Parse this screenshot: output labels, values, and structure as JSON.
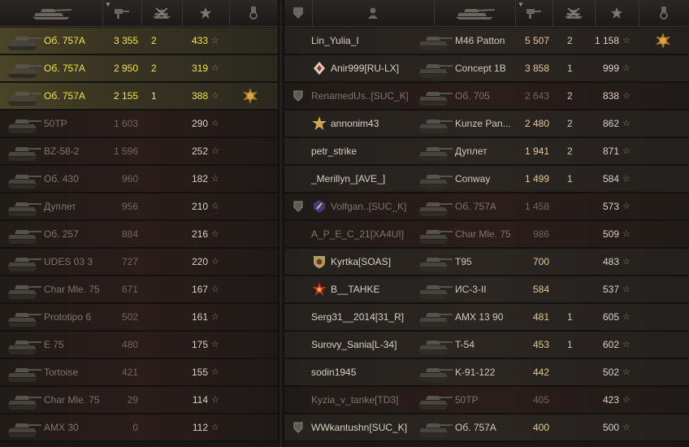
{
  "left_team": {
    "rows": [
      {
        "vehicle": "Об. 757А",
        "damage": "3 355",
        "frags": "2",
        "xp": "433",
        "state": "self",
        "medal": false
      },
      {
        "vehicle": "Об. 757А",
        "damage": "2 950",
        "frags": "2",
        "xp": "319",
        "state": "self",
        "medal": false
      },
      {
        "vehicle": "Об. 757А",
        "damage": "2 155",
        "frags": "1",
        "xp": "388",
        "state": "self",
        "medal": true
      },
      {
        "vehicle": "50TP",
        "damage": "1 603",
        "frags": "",
        "xp": "290",
        "state": "dead",
        "medal": false
      },
      {
        "vehicle": "BZ-58-2",
        "damage": "1 596",
        "frags": "",
        "xp": "252",
        "state": "dead",
        "medal": false
      },
      {
        "vehicle": "Об. 430",
        "damage": "960",
        "frags": "",
        "xp": "182",
        "state": "dead",
        "medal": false
      },
      {
        "vehicle": "Дуплет",
        "damage": "956",
        "frags": "",
        "xp": "210",
        "state": "dead",
        "medal": false
      },
      {
        "vehicle": "Об. 257",
        "damage": "884",
        "frags": "",
        "xp": "216",
        "state": "dead",
        "medal": false
      },
      {
        "vehicle": "UDES 03 3",
        "damage": "727",
        "frags": "",
        "xp": "220",
        "state": "dead",
        "medal": false
      },
      {
        "vehicle": "Char Mle. 75",
        "damage": "671",
        "frags": "",
        "xp": "167",
        "state": "dead",
        "medal": false
      },
      {
        "vehicle": "Prototipo 6",
        "damage": "502",
        "frags": "",
        "xp": "161",
        "state": "dead",
        "medal": false
      },
      {
        "vehicle": "E 75",
        "damage": "480",
        "frags": "",
        "xp": "175",
        "state": "dead",
        "medal": false
      },
      {
        "vehicle": "Tortoise",
        "damage": "421",
        "frags": "",
        "xp": "155",
        "state": "dead",
        "medal": false
      },
      {
        "vehicle": "Char Mle. 75",
        "damage": "29",
        "frags": "",
        "xp": "114",
        "state": "dead",
        "medal": false
      },
      {
        "vehicle": "AMX 30",
        "damage": "0",
        "frags": "",
        "xp": "112",
        "state": "dead",
        "medal": false
      }
    ]
  },
  "right_team": {
    "rows": [
      {
        "player": "Lin_Yulia_I",
        "vehicle": "M46 Patton",
        "damage": "5 507",
        "frags": "2",
        "xp": "1 158",
        "state": "alive",
        "medal": true,
        "platoon": false,
        "badge": ""
      },
      {
        "player": "Anir999[RU-LX]",
        "vehicle": "Concept 1B",
        "damage": "3 858",
        "frags": "1",
        "xp": "999",
        "state": "alive",
        "medal": false,
        "platoon": false,
        "badge": "diamond"
      },
      {
        "player": "RenamedUs..[SUC_K]",
        "vehicle": "Об. 705",
        "damage": "2 643",
        "frags": "2",
        "xp": "838",
        "state": "dead",
        "medal": false,
        "platoon": true,
        "badge": ""
      },
      {
        "player": "annonim43",
        "vehicle": "Kunze Pan...",
        "damage": "2 480",
        "frags": "2",
        "xp": "862",
        "state": "alive",
        "medal": false,
        "platoon": false,
        "badge": "gold-star"
      },
      {
        "player": "petr_strike",
        "vehicle": "Дуплет",
        "damage": "1 941",
        "frags": "2",
        "xp": "871",
        "state": "alive",
        "medal": false,
        "platoon": false,
        "badge": ""
      },
      {
        "player": "_Merillyn_[AVE_]",
        "vehicle": "Conway",
        "damage": "1 499",
        "frags": "1",
        "xp": "584",
        "state": "alive",
        "medal": false,
        "platoon": false,
        "badge": ""
      },
      {
        "player": "Volfgan..[SUC_K]",
        "vehicle": "Об. 757А",
        "damage": "1 458",
        "frags": "",
        "xp": "573",
        "state": "dead",
        "medal": false,
        "platoon": true,
        "badge": "blue-emblem"
      },
      {
        "player": "A_P_E_C_21[XA4UI]",
        "vehicle": "Char Mle. 75",
        "damage": "986",
        "frags": "",
        "xp": "509",
        "state": "dead",
        "medal": false,
        "platoon": false,
        "badge": ""
      },
      {
        "player": "Kyrtka[SOAS]",
        "vehicle": "T95",
        "damage": "700",
        "frags": "",
        "xp": "483",
        "state": "alive",
        "medal": false,
        "platoon": false,
        "badge": "shield"
      },
      {
        "player": "B__TAHKE",
        "vehicle": "ИС-3-II",
        "damage": "584",
        "frags": "",
        "xp": "537",
        "state": "alive",
        "medal": false,
        "platoon": false,
        "badge": "red-star"
      },
      {
        "player": "Serg31__2014[31_R]",
        "vehicle": "AMX 13 90",
        "damage": "481",
        "frags": "1",
        "xp": "605",
        "state": "alive",
        "medal": false,
        "platoon": false,
        "badge": ""
      },
      {
        "player": "Surovy_Sania[L-34]",
        "vehicle": "T-54",
        "damage": "453",
        "frags": "1",
        "xp": "602",
        "state": "alive",
        "medal": false,
        "platoon": false,
        "badge": ""
      },
      {
        "player": "sodin1945",
        "vehicle": "K-91-122",
        "damage": "442",
        "frags": "",
        "xp": "502",
        "state": "alive",
        "medal": false,
        "platoon": false,
        "badge": ""
      },
      {
        "player": "Kyzia_v_tanke[TD3]",
        "vehicle": "50TP",
        "damage": "405",
        "frags": "",
        "xp": "423",
        "state": "dead",
        "medal": false,
        "platoon": false,
        "badge": ""
      },
      {
        "player": "WWkantushn[SUC_K]",
        "vehicle": "Об. 757А",
        "damage": "400",
        "frags": "",
        "xp": "500",
        "state": "alive",
        "medal": false,
        "platoon": true,
        "badge": ""
      }
    ]
  },
  "icons": {
    "col_vehicle": "tank-icon",
    "col_damage": "damage-icon",
    "col_frags": "destroyed-tank-icon",
    "col_xp": "star-icon",
    "col_medal": "medal-icon",
    "col_platoon": "platoon-icon",
    "col_player": "player-icon",
    "row_xp": "star-icon"
  },
  "colors": {
    "self_text": "#f2e24a",
    "damage_alive": "#e3c993",
    "dead_text": "#7d766c"
  }
}
